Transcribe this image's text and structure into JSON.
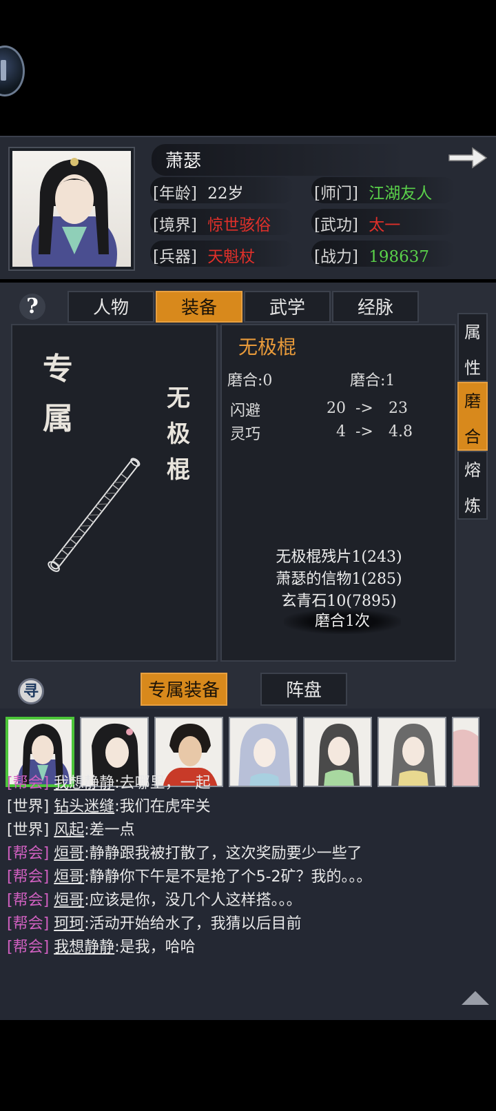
{
  "character": {
    "name": "萧瑟",
    "age_label": "[年龄]",
    "age_value": "22岁",
    "sect_label": "[师门]",
    "sect_value": "江湖友人",
    "realm_label": "[境界]",
    "realm_value": "惊世骇俗",
    "martial_label": "[武功]",
    "martial_value": "太一",
    "weapon_label": "[兵器]",
    "weapon_value": "天魁杖",
    "power_label": "[战力]",
    "power_value": "198637"
  },
  "tabs": [
    {
      "label": "人物"
    },
    {
      "label": "装备"
    },
    {
      "label": "武学"
    },
    {
      "label": "经脉"
    }
  ],
  "help": {
    "label": "?"
  },
  "equipment": {
    "exclusive_label": "专属",
    "weapon_name_vertical": "无极棍",
    "title": "无极棍",
    "refine_current": "磨合:0",
    "refine_next": "磨合:1",
    "stats": [
      {
        "name": "闪避",
        "from": "20",
        "arrow": "->",
        "to": "23"
      },
      {
        "name": "灵巧",
        "from": "4",
        "arrow": "->",
        "to": "4.8"
      }
    ],
    "materials": [
      "无极棍残片1(243)",
      "萧瑟的信物1(285)",
      "玄青石10(7895)"
    ],
    "refine_button": "磨合1次"
  },
  "side_tabs": [
    {
      "label_1": "属",
      "label_2": "性"
    },
    {
      "label_1": "磨",
      "label_2": "合"
    },
    {
      "label_1": "熔",
      "label_2": "炼"
    }
  ],
  "bottom_tabs": [
    {
      "label": "专属装备"
    },
    {
      "label": "阵盘"
    }
  ],
  "seek_icon_label": "寻",
  "chat": [
    {
      "channel": "[帮会]",
      "channel_type": "guild",
      "speaker": "我想静静",
      "text": ":去哪里，一起"
    },
    {
      "channel": "[世界]",
      "channel_type": "world",
      "speaker": "钻头迷缝",
      "text": ":我们在虎牢关"
    },
    {
      "channel": "[世界]",
      "channel_type": "world",
      "speaker": "风起",
      "text": ":差一点"
    },
    {
      "channel": "[帮会]",
      "channel_type": "guild",
      "speaker": "烜哥",
      "text": ":静静跟我被打散了，这次奖励要少一些了"
    },
    {
      "channel": "[帮会]",
      "channel_type": "guild",
      "speaker": "烜哥",
      "text": ":静静你下午是不是抢了个5-2矿？我的。。。"
    },
    {
      "channel": "[帮会]",
      "channel_type": "guild",
      "speaker": "烜哥",
      "text": ":应该是你，没几个人这样搭。。。"
    },
    {
      "channel": "[帮会]",
      "channel_type": "guild",
      "speaker": "珂珂",
      "text": ":活动开始给水了，我猜以后目前"
    },
    {
      "channel": "[帮会]",
      "channel_type": "guild",
      "speaker": "我想静静",
      "text": ":是我，哈哈"
    }
  ],
  "colors": {
    "accent_orange": "#d8891c",
    "title_orange": "#e89a3a",
    "green": "#5ad14a",
    "red": "#e0302a",
    "guild_purple": "#d060c0"
  }
}
